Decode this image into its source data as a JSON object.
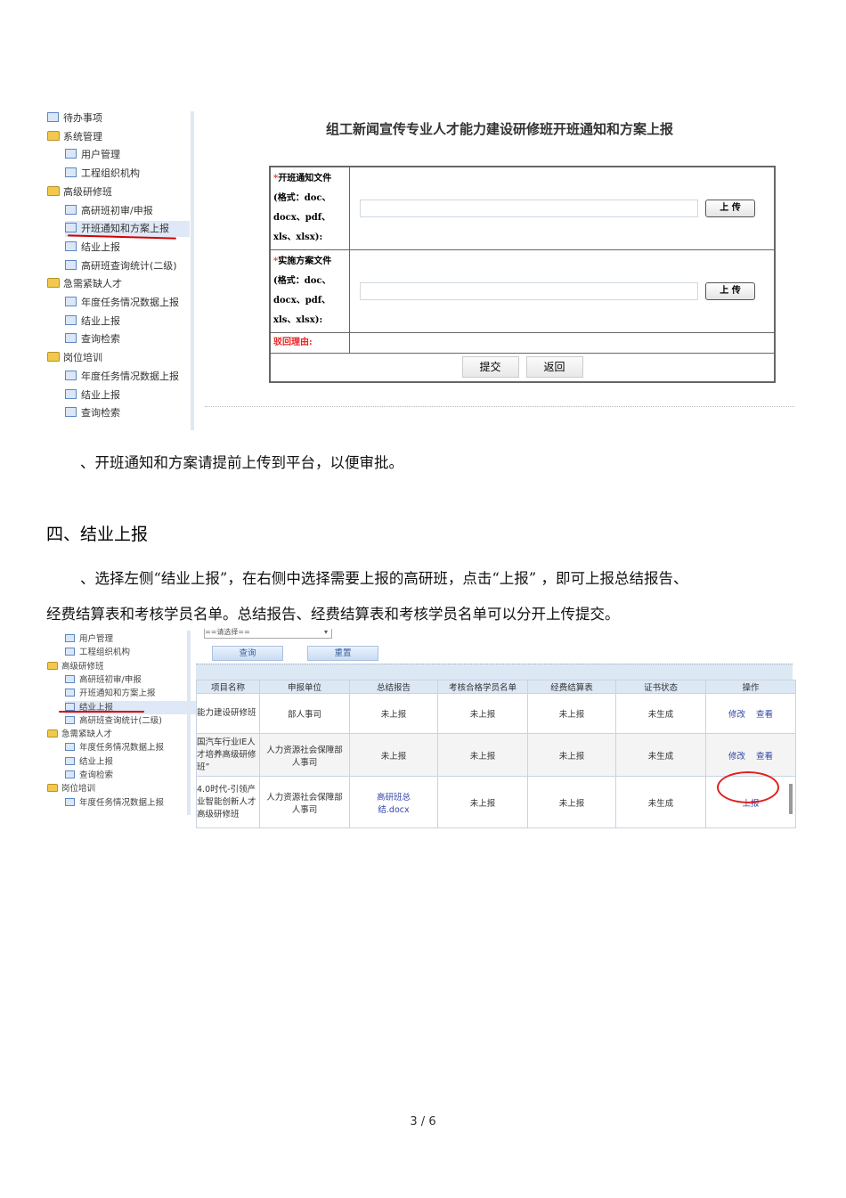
{
  "screenshot1": {
    "sidebar": [
      {
        "label": "待办事项",
        "type": "item",
        "level": 0
      },
      {
        "label": "系统管理",
        "type": "folder",
        "level": 0
      },
      {
        "label": "用户管理",
        "type": "item",
        "level": 1
      },
      {
        "label": "工程组织机构",
        "type": "item",
        "level": 1
      },
      {
        "label": "高级研修班",
        "type": "folder",
        "level": 0
      },
      {
        "label": "高研班初审/申报",
        "type": "item",
        "level": 1
      },
      {
        "label": "开班通知和方案上报",
        "type": "item",
        "level": 1,
        "selected": true
      },
      {
        "label": "结业上报",
        "type": "item",
        "level": 1
      },
      {
        "label": "高研班查询统计(二级)",
        "type": "item",
        "level": 1
      },
      {
        "label": "急需紧缺人才",
        "type": "folder",
        "level": 0
      },
      {
        "label": "年度任务情况数据上报",
        "type": "item",
        "level": 1
      },
      {
        "label": "结业上报",
        "type": "item",
        "level": 1
      },
      {
        "label": "查询检索",
        "type": "item",
        "level": 1
      },
      {
        "label": "岗位培训",
        "type": "folder",
        "level": 0
      },
      {
        "label": "年度任务情况数据上报",
        "type": "item",
        "level": 1
      },
      {
        "label": "结业上报",
        "type": "item",
        "level": 1
      },
      {
        "label": "查询检索",
        "type": "item",
        "level": 1
      }
    ],
    "title": "组工新闻宣传专业人才能力建设研修班开班通知和方案上报",
    "form": {
      "field1_req": "*",
      "field1_label": "开班通知文件",
      "field1_format": [
        "(格式：doc、",
        "docx、pdf、",
        "xls、xlsx):"
      ],
      "field2_req": "*",
      "field2_label": "实施方案文件",
      "field2_format": [
        "(格式：doc、",
        "docx、pdf、",
        "xls、xlsx):"
      ],
      "upload": "上 传",
      "reject_label": "驳回理由:",
      "submit": "提交",
      "back": "返回"
    }
  },
  "text": {
    "p1": "、开班通知和方案请提前上传到平台，以便审批。",
    "heading": "四、结业上报",
    "p2_line1": "、选择左侧“结业上报”，在右侧中选择需要上报的高研班，点击“上报”    ，即可上报总结报告、",
    "p2_line2": "经费结算表和考核学员名单。总结报告、经费结算表和考核学员名单可以分开上传提交。"
  },
  "screenshot2": {
    "sidebar": [
      {
        "label": "用户管理",
        "type": "item",
        "level": 1
      },
      {
        "label": "工程组织机构",
        "type": "item",
        "level": 1
      },
      {
        "label": "高级研修班",
        "type": "folder",
        "level": 0
      },
      {
        "label": "高研班初审/申报",
        "type": "item",
        "level": 1
      },
      {
        "label": "开班通知和方案上报",
        "type": "item",
        "level": 1
      },
      {
        "label": "结业上报",
        "type": "item",
        "level": 1,
        "selected": true
      },
      {
        "label": "高研班查询统计(二级)",
        "type": "item",
        "level": 1
      },
      {
        "label": "急需紧缺人才",
        "type": "folder",
        "level": 0
      },
      {
        "label": "年度任务情况数据上报",
        "type": "item",
        "level": 1
      },
      {
        "label": "结业上报",
        "type": "item",
        "level": 1
      },
      {
        "label": "查询检索",
        "type": "item",
        "level": 1
      },
      {
        "label": "岗位培训",
        "type": "folder",
        "level": 0
      },
      {
        "label": "年度任务情况数据上报",
        "type": "item",
        "level": 1
      }
    ],
    "select_value": "==请选择==",
    "query": "查询",
    "reset": "重置",
    "columns": [
      "项目名称",
      "申报单位",
      "总结报告",
      "考核合格学员名单",
      "经费结算表",
      "证书状态",
      "操作"
    ],
    "rows": [
      {
        "name": "能力建设研修班",
        "unit": "部人事司",
        "report": "未上报",
        "list": "未上报",
        "fee": "未上报",
        "cert": "未生成",
        "actions": [
          "修改",
          "查看"
        ]
      },
      {
        "name": "国汽车行业IE人才培养高级研修班”",
        "unit": "人力资源社会保障部人事司",
        "report": "未上报",
        "list": "未上报",
        "fee": "未上报",
        "cert": "未生成",
        "actions": [
          "修改",
          "查看"
        ]
      },
      {
        "name": "4.0时代-引领产业智能创新人才高级研修班",
        "unit": "人力资源社会保障部人事司",
        "report": "高研班总结.docx",
        "list": "未上报",
        "fee": "未上报",
        "cert": "未生成",
        "actions": [
          "上报"
        ]
      }
    ]
  },
  "footer": {
    "page": "3 / 6"
  }
}
